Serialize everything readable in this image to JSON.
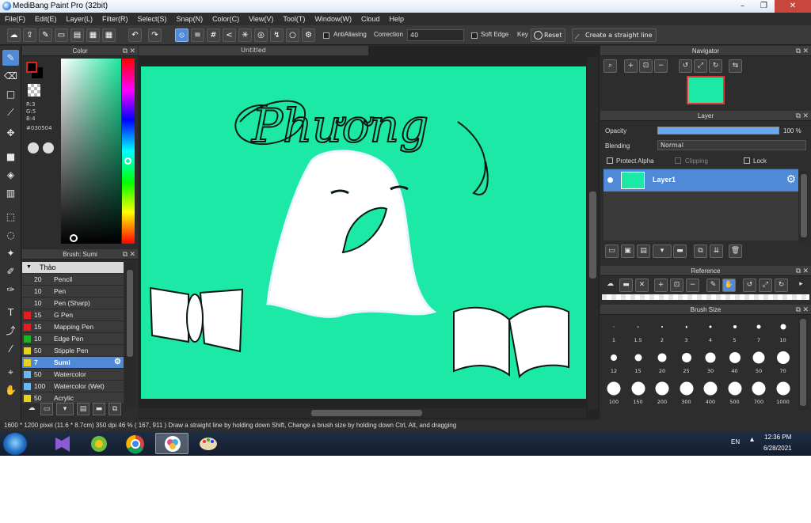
{
  "window": {
    "title": "MediBang Paint Pro (32bit)",
    "minimize": "–",
    "maximize": "❐",
    "close": "✕"
  },
  "menu": [
    "File(F)",
    "Edit(E)",
    "Layer(L)",
    "Filter(R)",
    "Select(S)",
    "Snap(N)",
    "Color(C)",
    "View(V)",
    "Tool(T)",
    "Window(W)",
    "Cloud",
    "Help"
  ],
  "toolbar": {
    "antialiasing_label": "AntiAliasing",
    "correction_label": "Correction",
    "correction_value": "40",
    "soft_edge_label": "Soft Edge",
    "key_label": "Key",
    "reset_label": "Reset",
    "straight_line_label": "Create a straight line"
  },
  "color_panel": {
    "title": "Color",
    "r": "R:3",
    "g": "G:5",
    "b": "B:4",
    "hex": "#030504",
    "foreground": "#030504",
    "hue_color": "#1fe69e"
  },
  "brush_panel": {
    "title": "Brush: Sumi",
    "group": "Thảo",
    "brushes": [
      {
        "size": "20",
        "name": "Pencil",
        "color": "#3b3b3b",
        "selected": false
      },
      {
        "size": "10",
        "name": "Pen",
        "color": "#3b3b3b",
        "selected": false
      },
      {
        "size": "10",
        "name": "Pen (Sharp)",
        "color": "#3b3b3b",
        "selected": false
      },
      {
        "size": "15",
        "name": "G Pen",
        "color": "#e02020",
        "selected": false
      },
      {
        "size": "15",
        "name": "Mapping Pen",
        "color": "#e02020",
        "selected": false
      },
      {
        "size": "10",
        "name": "Edge Pen",
        "color": "#20b020",
        "selected": false
      },
      {
        "size": "50",
        "name": "Stipple Pen",
        "color": "#e8d020",
        "selected": false
      },
      {
        "size": "7",
        "name": "Sumi",
        "color": "#e8d020",
        "selected": true
      },
      {
        "size": "50",
        "name": "Watercolor",
        "color": "#6ab8f0",
        "selected": false
      },
      {
        "size": "100",
        "name": "Watercolor (Wet)",
        "color": "#6ab8f0",
        "selected": false
      },
      {
        "size": "50",
        "name": "Acrylic",
        "color": "#e8d020",
        "selected": false
      }
    ]
  },
  "canvas": {
    "tab": "Untitled",
    "background": "#1de9a6",
    "text": "Phương"
  },
  "navigator": {
    "title": "Navigator"
  },
  "layer_panel": {
    "title": "Layer",
    "opacity_label": "Opacity",
    "opacity_value": "100 %",
    "opacity": 1.0,
    "blending_label": "Blending",
    "blending_value": "Normal",
    "protect_alpha": "Protect Alpha",
    "clipping": "Clipping",
    "lock": "Lock",
    "layer_name": "Layer1"
  },
  "reference": {
    "title": "Reference"
  },
  "brush_size": {
    "title": "Brush Size",
    "sizes": [
      "1",
      "1.5",
      "2",
      "3",
      "4",
      "5",
      "7",
      "10",
      "12",
      "15",
      "20",
      "25",
      "30",
      "40",
      "50",
      "70",
      "100",
      "150",
      "200",
      "300",
      "400",
      "500",
      "700",
      "1000"
    ]
  },
  "status": {
    "text": "1600 * 1200 pixel   (11.6 * 8.7cm)   350 dpi   46 %   ( 167, 911 )   Draw a straight line by holding down Shift, Change a brush size by holding down Ctrl, Alt, and dragging"
  },
  "taskbar": {
    "lang": "EN",
    "time": "12:36 PM",
    "date": "6/28/2021"
  }
}
